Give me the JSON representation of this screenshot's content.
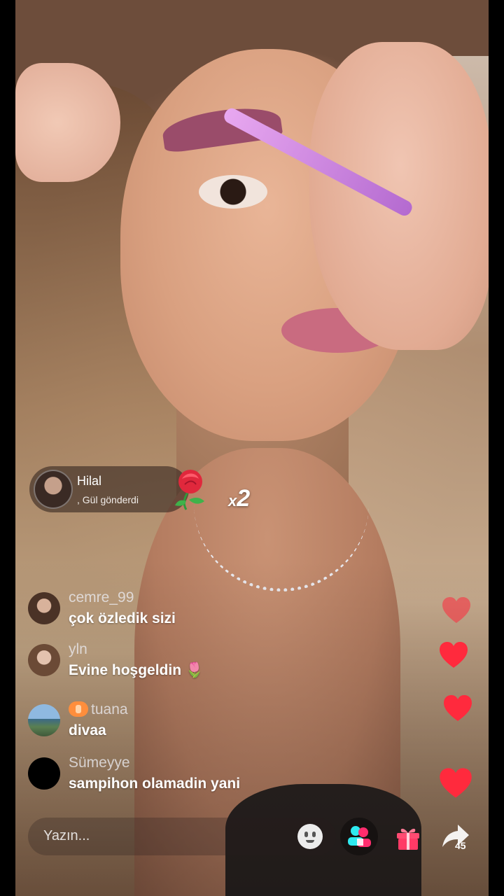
{
  "gift_notice": {
    "sender": "Hilal",
    "text": ", Gül  gönderdi",
    "gift_icon": "rose-icon",
    "combo_prefix": "x",
    "combo_count": "2"
  },
  "comments": [
    {
      "user": "cemre_99",
      "message": "çok özledik sizi",
      "avatar": "avatar-photo"
    },
    {
      "user": "yln",
      "message": "Evine hoşgeldin 🌷",
      "avatar": "avatar-photo"
    },
    {
      "user": "tuana",
      "message": "divaa",
      "avatar": "avatar-lake-photo",
      "badge": "heart-level-badge"
    },
    {
      "user": "Sümeyye",
      "message": "sampihon olamadin yani",
      "avatar": "avatar-black"
    }
  ],
  "bottom_bar": {
    "placeholder": "Yazın...",
    "share_count": "45"
  },
  "colors": {
    "heart_red": "#ff2a3d",
    "guest_cyan": "#2ee9f0",
    "guest_pink": "#ff2d6e"
  }
}
